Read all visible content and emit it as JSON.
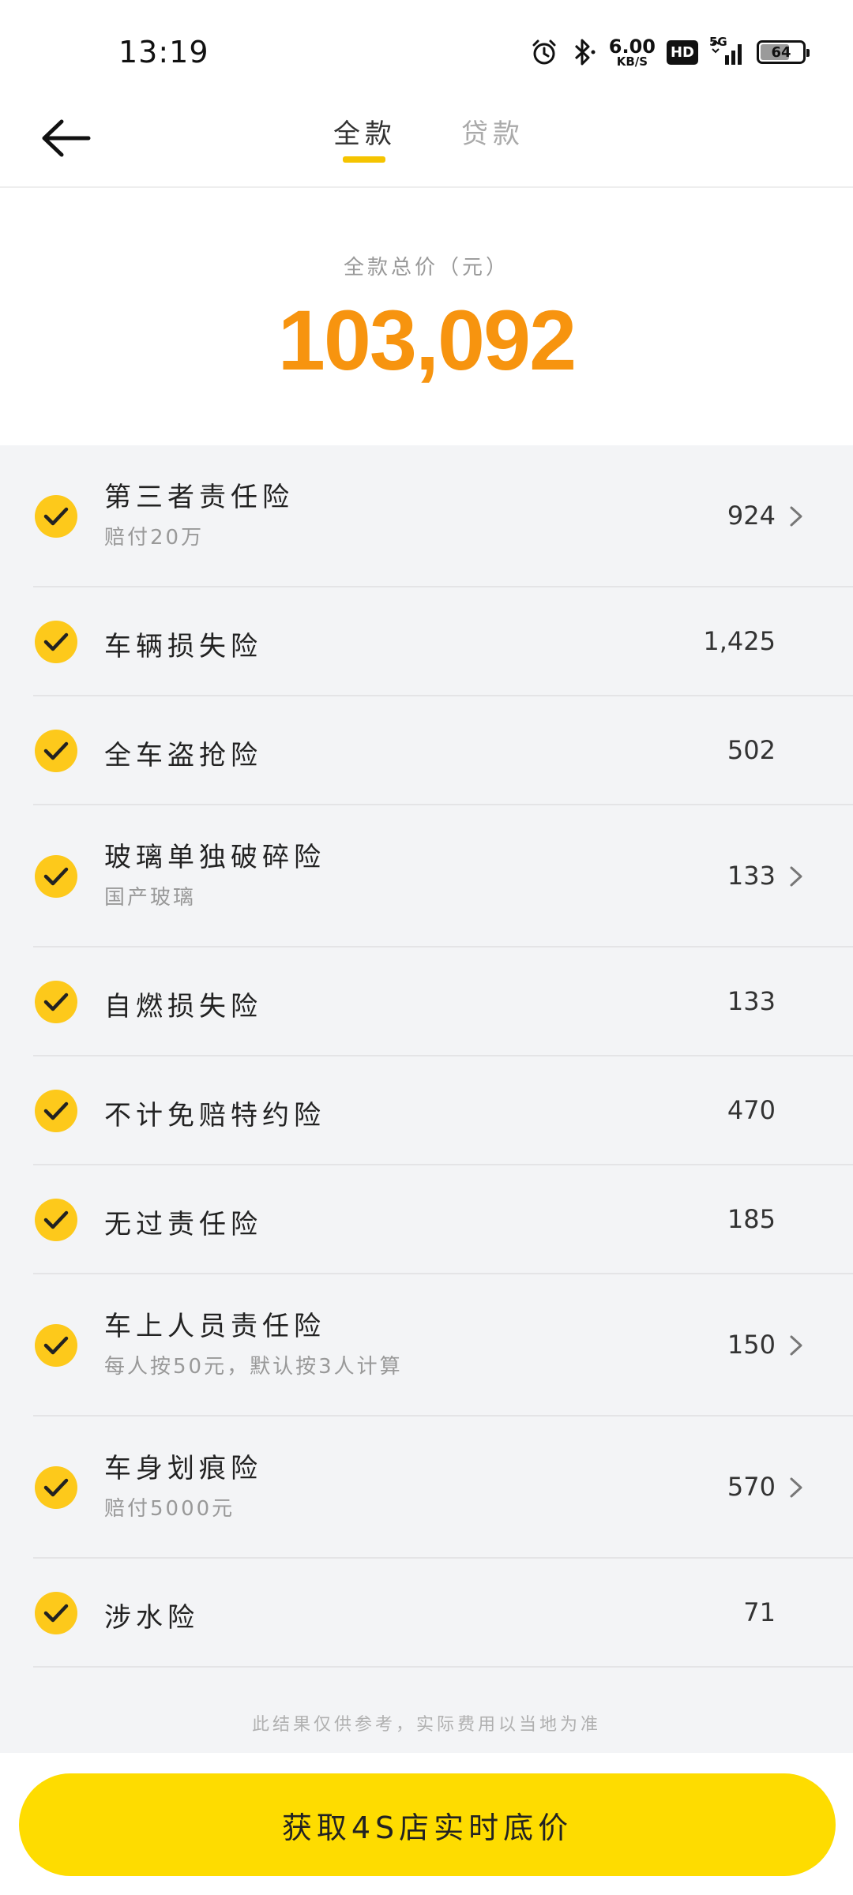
{
  "status_bar": {
    "time": "13:19",
    "net_speed_value": "6.00",
    "net_speed_unit": "KB/S",
    "hd_label": "HD",
    "network_label": "5G",
    "battery_level": "64",
    "icons": [
      "alarm-icon",
      "bluetooth-icon",
      "hd-icon",
      "signal-icon",
      "battery-icon"
    ]
  },
  "nav": {
    "back_icon": "back-arrow-icon",
    "tabs": [
      {
        "label": "全款",
        "active": true
      },
      {
        "label": "贷款",
        "active": false
      }
    ],
    "accent_color": "#f5c400"
  },
  "price": {
    "label": "全款总价（元）",
    "value": "103,092",
    "color": "#f7940f"
  },
  "insurance_items": [
    {
      "title": "第三者责任险",
      "subtitle": "赔付20万",
      "amount": "924",
      "has_detail": true
    },
    {
      "title": "车辆损失险",
      "subtitle": "",
      "amount": "1,425",
      "has_detail": false
    },
    {
      "title": "全车盗抢险",
      "subtitle": "",
      "amount": "502",
      "has_detail": false
    },
    {
      "title": "玻璃单独破碎险",
      "subtitle": "国产玻璃",
      "amount": "133",
      "has_detail": true
    },
    {
      "title": "自燃损失险",
      "subtitle": "",
      "amount": "133",
      "has_detail": false
    },
    {
      "title": "不计免赔特约险",
      "subtitle": "",
      "amount": "470",
      "has_detail": false
    },
    {
      "title": "无过责任险",
      "subtitle": "",
      "amount": "185",
      "has_detail": false
    },
    {
      "title": "车上人员责任险",
      "subtitle": "每人按50元，默认按3人计算",
      "amount": "150",
      "has_detail": true
    },
    {
      "title": "车身划痕险",
      "subtitle": "赔付5000元",
      "amount": "570",
      "has_detail": true
    },
    {
      "title": "涉水险",
      "subtitle": "",
      "amount": "71",
      "has_detail": false
    }
  ],
  "disclaimer": "此结果仅供参考，实际费用以当地为准",
  "cta": {
    "label": "获取4S店实时底价",
    "color": "#fedc00"
  }
}
